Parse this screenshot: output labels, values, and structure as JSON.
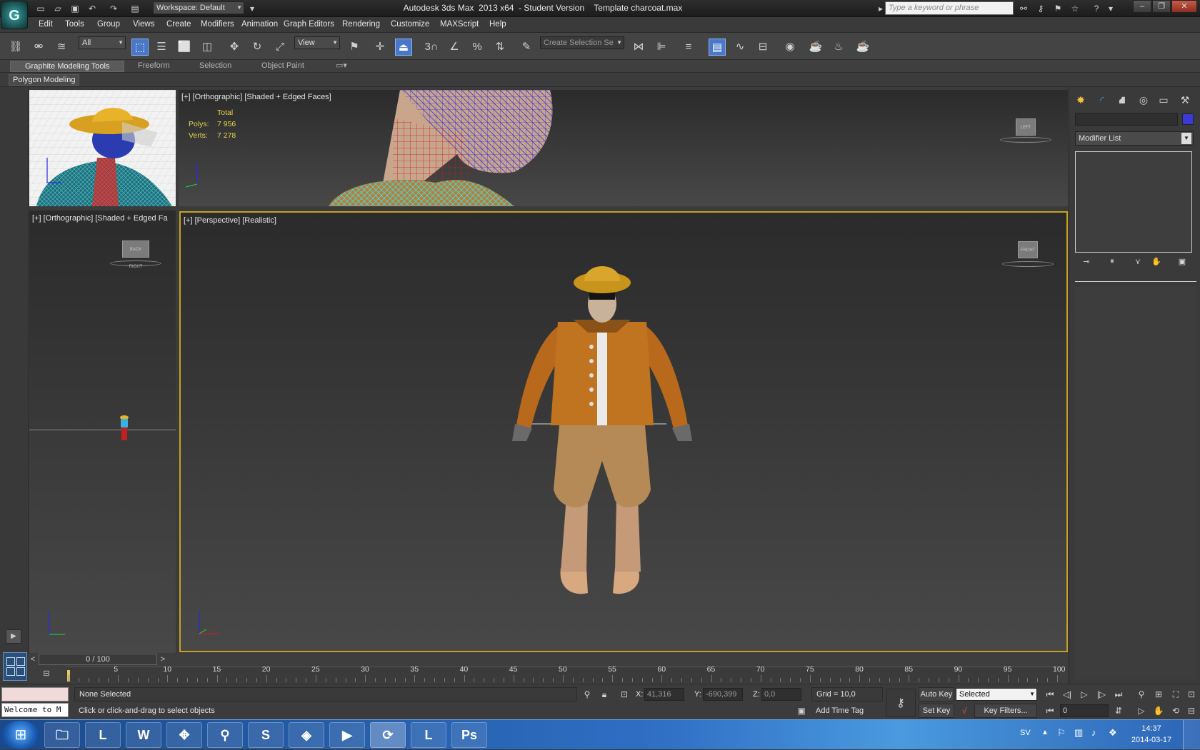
{
  "title_bar": {
    "workspace": "Workspace: Default",
    "window_title": "Autodesk 3ds Max  2013 x64  - Student Version    Template charcoat.max",
    "search_placeholder": "Type a keyword or phrase",
    "app_logo_icon": "3dsmax-logo-icon"
  },
  "menus": [
    "Edit",
    "Tools",
    "Group",
    "Views",
    "Create",
    "Modifiers",
    "Animation",
    "Graph Editors",
    "Rendering",
    "Customize",
    "MAXScript",
    "Help"
  ],
  "toolbar": {
    "selection_filter": "All",
    "ref_coord": "View",
    "named_selection_placeholder": "Create Selection Se",
    "snap_label": "3"
  },
  "ribbon": {
    "tabs": [
      "Graphite Modeling Tools",
      "Freeform",
      "Selection",
      "Object Paint"
    ],
    "subtab": "Polygon Modeling"
  },
  "viewports": {
    "top": {
      "label": "[+] [Orthographic] [Shaded + Edged Faces]",
      "stats_title": "Total",
      "polys_label": "Polys:",
      "polys_value": "7 956",
      "verts_label": "Verts:",
      "verts_value": "7 278",
      "cube_label": "LEFT"
    },
    "left": {
      "label": "[+] [Orthographic] [Shaded + Edged Fa",
      "cube_label": "BACK RIGHT"
    },
    "perspective": {
      "label": "[+] [Perspective] [Realistic]",
      "cube_label": "FRONT"
    }
  },
  "command_panel": {
    "tabs": [
      "create-icon",
      "modify-icon",
      "hierarchy-icon",
      "motion-icon",
      "display-icon",
      "utilities-icon"
    ],
    "modifier_list": "Modifier List",
    "color_swatch": "#3a3ad8"
  },
  "timeline": {
    "slider_text": "0 / 100",
    "ticks": [
      5,
      10,
      15,
      20,
      25,
      30,
      35,
      40,
      45,
      50,
      55,
      60,
      65,
      70,
      75,
      80,
      85,
      90,
      95,
      100
    ]
  },
  "status_bar": {
    "listener": "Welcome to M",
    "selection_status": "None Selected",
    "prompt": "Click or click-and-drag to select objects",
    "x_label": "X:",
    "x_value": "41,316",
    "y_label": "Y:",
    "y_value": "-690,399",
    "z_label": "Z:",
    "z_value": "0,0",
    "grid": "Grid = 10,0",
    "add_time_tag": "Add Time Tag",
    "auto_key": "Auto Key",
    "set_key": "Set Key",
    "key_mode": "Selected",
    "key_filters": "Key Filters...",
    "frame": "0"
  },
  "taskbar": {
    "language": "SV",
    "time": "14:37",
    "date": "2014-03-17",
    "apps": [
      {
        "name": "explorer-icon",
        "glyph": "🗀"
      },
      {
        "name": "league-of-legends-icon",
        "glyph": "L"
      },
      {
        "name": "world-of-warcraft-icon",
        "glyph": "W"
      },
      {
        "name": "starcraft-icon",
        "glyph": "✥"
      },
      {
        "name": "search-icon",
        "glyph": "⚲"
      },
      {
        "name": "skype-icon",
        "glyph": "S"
      },
      {
        "name": "heroes-icon",
        "glyph": "◈"
      },
      {
        "name": "media-player-icon",
        "glyph": "▶"
      },
      {
        "name": "3dsmax-icon",
        "glyph": "⟳"
      },
      {
        "name": "league-of-legends-icon",
        "glyph": "L"
      },
      {
        "name": "photoshop-icon",
        "glyph": "Ps"
      }
    ]
  }
}
